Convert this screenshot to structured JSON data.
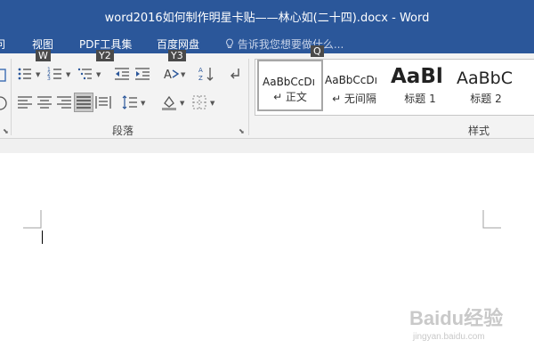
{
  "window": {
    "title": "word2016如何制作明星卡贴——林心如(二十四).docx - Word"
  },
  "menu": {
    "items": [
      "问",
      "视图",
      "PDF工具集",
      "百度网盘"
    ],
    "tell_me": "告诉我您想要做什么..."
  },
  "keytips": {
    "view": "W",
    "pdf": "Y2",
    "baidu": "Y3",
    "tellme": "Q"
  },
  "ribbon": {
    "paragraph_group_label": "段落",
    "styles_group_label": "样式",
    "styles": [
      {
        "preview": "AaBbCcDı",
        "label": "↵ 正文",
        "selected": true
      },
      {
        "preview": "AaBbCcDı",
        "label": "↵ 无间隔",
        "selected": false
      },
      {
        "preview": "AaBl",
        "label": "标题 1",
        "selected": false
      },
      {
        "preview": "AaBbC",
        "label": "标题 2",
        "selected": false
      }
    ]
  },
  "watermark": {
    "text": "Baidu经验",
    "sub": "jingyan.baidu.com"
  },
  "colors": {
    "titlebar": "#2b579a",
    "ribbon": "#f3f3f3",
    "keytip": "#4a4a4a"
  },
  "icons": [
    "bullets-icon",
    "numbering-icon",
    "multilevel-list-icon",
    "decrease-indent-icon",
    "increase-indent-icon",
    "text-direction-icon",
    "sort-icon",
    "show-marks-icon",
    "align-left-icon",
    "center-icon",
    "align-right-icon",
    "justify-icon",
    "distributed-icon",
    "line-spacing-icon",
    "shading-icon",
    "borders-icon"
  ]
}
